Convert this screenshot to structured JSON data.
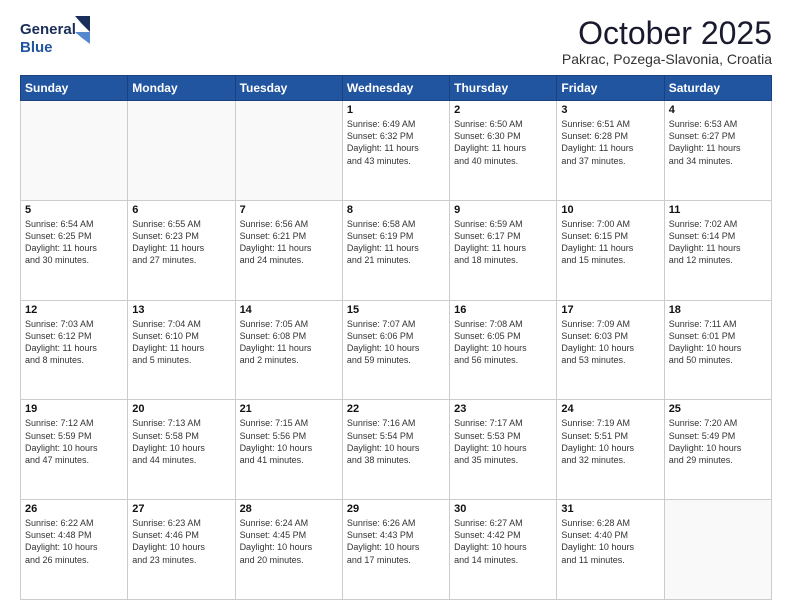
{
  "header": {
    "logo_line1": "General",
    "logo_line2": "Blue",
    "title": "October 2025",
    "subtitle": "Pakrac, Pozega-Slavonia, Croatia"
  },
  "weekdays": [
    "Sunday",
    "Monday",
    "Tuesday",
    "Wednesday",
    "Thursday",
    "Friday",
    "Saturday"
  ],
  "weeks": [
    [
      {
        "day": "",
        "info": ""
      },
      {
        "day": "",
        "info": ""
      },
      {
        "day": "",
        "info": ""
      },
      {
        "day": "1",
        "info": "Sunrise: 6:49 AM\nSunset: 6:32 PM\nDaylight: 11 hours\nand 43 minutes."
      },
      {
        "day": "2",
        "info": "Sunrise: 6:50 AM\nSunset: 6:30 PM\nDaylight: 11 hours\nand 40 minutes."
      },
      {
        "day": "3",
        "info": "Sunrise: 6:51 AM\nSunset: 6:28 PM\nDaylight: 11 hours\nand 37 minutes."
      },
      {
        "day": "4",
        "info": "Sunrise: 6:53 AM\nSunset: 6:27 PM\nDaylight: 11 hours\nand 34 minutes."
      }
    ],
    [
      {
        "day": "5",
        "info": "Sunrise: 6:54 AM\nSunset: 6:25 PM\nDaylight: 11 hours\nand 30 minutes."
      },
      {
        "day": "6",
        "info": "Sunrise: 6:55 AM\nSunset: 6:23 PM\nDaylight: 11 hours\nand 27 minutes."
      },
      {
        "day": "7",
        "info": "Sunrise: 6:56 AM\nSunset: 6:21 PM\nDaylight: 11 hours\nand 24 minutes."
      },
      {
        "day": "8",
        "info": "Sunrise: 6:58 AM\nSunset: 6:19 PM\nDaylight: 11 hours\nand 21 minutes."
      },
      {
        "day": "9",
        "info": "Sunrise: 6:59 AM\nSunset: 6:17 PM\nDaylight: 11 hours\nand 18 minutes."
      },
      {
        "day": "10",
        "info": "Sunrise: 7:00 AM\nSunset: 6:15 PM\nDaylight: 11 hours\nand 15 minutes."
      },
      {
        "day": "11",
        "info": "Sunrise: 7:02 AM\nSunset: 6:14 PM\nDaylight: 11 hours\nand 12 minutes."
      }
    ],
    [
      {
        "day": "12",
        "info": "Sunrise: 7:03 AM\nSunset: 6:12 PM\nDaylight: 11 hours\nand 8 minutes."
      },
      {
        "day": "13",
        "info": "Sunrise: 7:04 AM\nSunset: 6:10 PM\nDaylight: 11 hours\nand 5 minutes."
      },
      {
        "day": "14",
        "info": "Sunrise: 7:05 AM\nSunset: 6:08 PM\nDaylight: 11 hours\nand 2 minutes."
      },
      {
        "day": "15",
        "info": "Sunrise: 7:07 AM\nSunset: 6:06 PM\nDaylight: 10 hours\nand 59 minutes."
      },
      {
        "day": "16",
        "info": "Sunrise: 7:08 AM\nSunset: 6:05 PM\nDaylight: 10 hours\nand 56 minutes."
      },
      {
        "day": "17",
        "info": "Sunrise: 7:09 AM\nSunset: 6:03 PM\nDaylight: 10 hours\nand 53 minutes."
      },
      {
        "day": "18",
        "info": "Sunrise: 7:11 AM\nSunset: 6:01 PM\nDaylight: 10 hours\nand 50 minutes."
      }
    ],
    [
      {
        "day": "19",
        "info": "Sunrise: 7:12 AM\nSunset: 5:59 PM\nDaylight: 10 hours\nand 47 minutes."
      },
      {
        "day": "20",
        "info": "Sunrise: 7:13 AM\nSunset: 5:58 PM\nDaylight: 10 hours\nand 44 minutes."
      },
      {
        "day": "21",
        "info": "Sunrise: 7:15 AM\nSunset: 5:56 PM\nDaylight: 10 hours\nand 41 minutes."
      },
      {
        "day": "22",
        "info": "Sunrise: 7:16 AM\nSunset: 5:54 PM\nDaylight: 10 hours\nand 38 minutes."
      },
      {
        "day": "23",
        "info": "Sunrise: 7:17 AM\nSunset: 5:53 PM\nDaylight: 10 hours\nand 35 minutes."
      },
      {
        "day": "24",
        "info": "Sunrise: 7:19 AM\nSunset: 5:51 PM\nDaylight: 10 hours\nand 32 minutes."
      },
      {
        "day": "25",
        "info": "Sunrise: 7:20 AM\nSunset: 5:49 PM\nDaylight: 10 hours\nand 29 minutes."
      }
    ],
    [
      {
        "day": "26",
        "info": "Sunrise: 6:22 AM\nSunset: 4:48 PM\nDaylight: 10 hours\nand 26 minutes."
      },
      {
        "day": "27",
        "info": "Sunrise: 6:23 AM\nSunset: 4:46 PM\nDaylight: 10 hours\nand 23 minutes."
      },
      {
        "day": "28",
        "info": "Sunrise: 6:24 AM\nSunset: 4:45 PM\nDaylight: 10 hours\nand 20 minutes."
      },
      {
        "day": "29",
        "info": "Sunrise: 6:26 AM\nSunset: 4:43 PM\nDaylight: 10 hours\nand 17 minutes."
      },
      {
        "day": "30",
        "info": "Sunrise: 6:27 AM\nSunset: 4:42 PM\nDaylight: 10 hours\nand 14 minutes."
      },
      {
        "day": "31",
        "info": "Sunrise: 6:28 AM\nSunset: 4:40 PM\nDaylight: 10 hours\nand 11 minutes."
      },
      {
        "day": "",
        "info": ""
      }
    ]
  ],
  "colors": {
    "header_bg": "#2255a0",
    "header_text": "#ffffff",
    "border": "#cccccc"
  }
}
